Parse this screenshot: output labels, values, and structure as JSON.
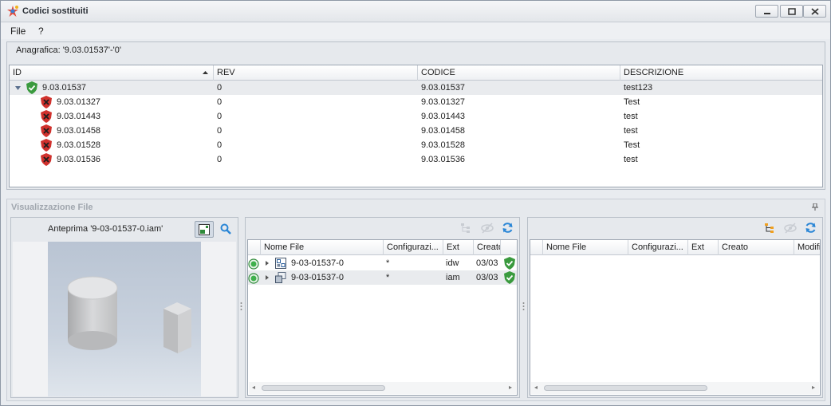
{
  "window": {
    "title": "Codici sostituiti"
  },
  "menu": {
    "file": "File",
    "help": "?"
  },
  "anagrafica": {
    "label": "Anagrafica: '9.03.01537'-'0'",
    "columns": [
      "ID",
      "REV",
      "CODICE",
      "DESCRIZIONE"
    ],
    "rows": [
      {
        "id": "9.03.01537",
        "rev": "0",
        "codice": "9.03.01537",
        "descrizione": "test123",
        "status": "ok",
        "expanded": true
      },
      {
        "id": "9.03.01327",
        "rev": "0",
        "codice": "9.03.01327",
        "descrizione": "Test",
        "status": "error"
      },
      {
        "id": "9.03.01443",
        "rev": "0",
        "codice": "9.03.01443",
        "descrizione": "test",
        "status": "error"
      },
      {
        "id": "9.03.01458",
        "rev": "0",
        "codice": "9.03.01458",
        "descrizione": "test",
        "status": "error"
      },
      {
        "id": "9.03.01528",
        "rev": "0",
        "codice": "9.03.01528",
        "descrizione": "Test",
        "status": "error"
      },
      {
        "id": "9.03.01536",
        "rev": "0",
        "codice": "9.03.01536",
        "descrizione": "test",
        "status": "error"
      }
    ]
  },
  "visualizzazione": {
    "title": "Visualizzazione File",
    "preview_title": "Anteprima '9-03-01537-0.iam'",
    "files_grid": {
      "columns": [
        "Nome File",
        "Configurazi...",
        "Ext",
        "Creato"
      ],
      "rows": [
        {
          "name": "9-03-01537-0",
          "config": "*",
          "ext": "idw",
          "created": "03/03",
          "icon": "drawing-file-icon"
        },
        {
          "name": "9-03-01537-0",
          "config": "*",
          "ext": "iam",
          "created": "03/03",
          "icon": "assembly-file-icon"
        }
      ]
    },
    "right_grid": {
      "columns": [
        "Nome File",
        "Configurazi...",
        "Ext",
        "Creato",
        "Modific"
      ]
    }
  },
  "colors": {
    "ok_green": "#3a9a3e",
    "error_red": "#d0312d",
    "refresh_blue": "#2a86d6",
    "hierarchy_orange": "#f0a020"
  }
}
